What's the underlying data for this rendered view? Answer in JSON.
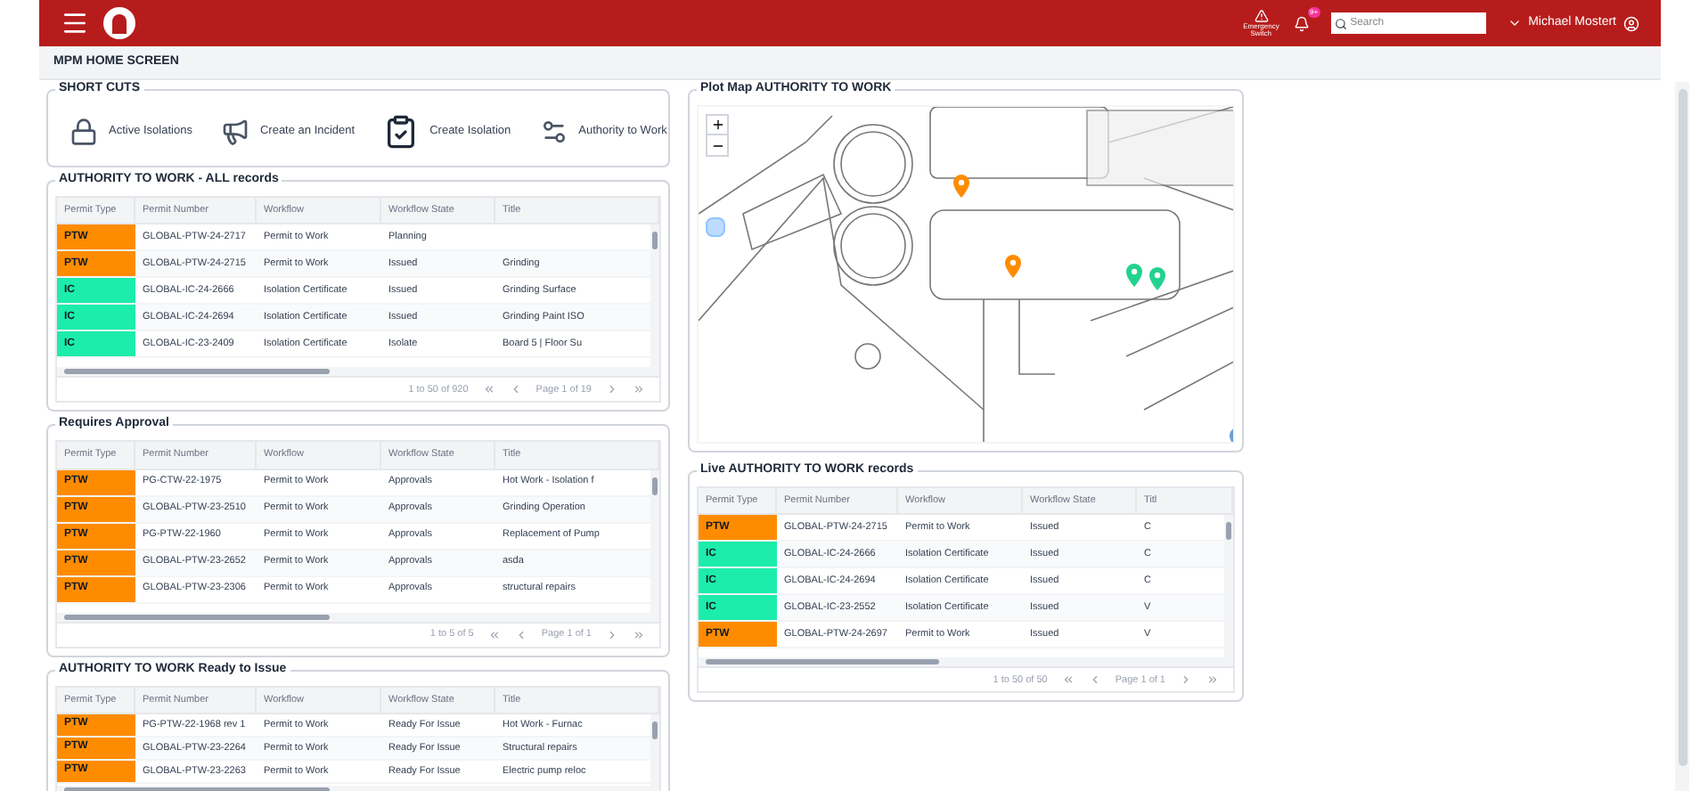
{
  "header": {
    "emergency_label": "Emergency Switch",
    "notification_badge": "9+",
    "search": {
      "placeholder": "Search"
    },
    "user": "Michael Mostert"
  },
  "page_title": "MPM HOME SCREEN",
  "shortcuts": {
    "title": "SHORT CUTS",
    "items": [
      {
        "kind": "isolations",
        "label": "Active Isolations"
      },
      {
        "kind": "incident",
        "label": "Create an Incident"
      },
      {
        "kind": "create_isolation",
        "label": "Create Isolation"
      },
      {
        "kind": "authority",
        "label": "Authority to Work"
      }
    ]
  },
  "tables": [
    {
      "title": "AUTHORITY TO WORK - ALL records",
      "columns": [
        "Permit Type",
        "Permit Number",
        "Workflow",
        "Workflow State",
        "Title"
      ],
      "rows": [
        {
          "cells": [
            "PTW",
            "GLOBAL-PTW-24-2717",
            "Permit to Work",
            "Planning",
            ""
          ],
          "color": "#ff8c00"
        },
        {
          "cells": [
            "PTW",
            "GLOBAL-PTW-24-2715",
            "Permit to Work",
            "Issued",
            "Grinding"
          ],
          "color": "#ff8c00"
        },
        {
          "cells": [
            "IC",
            "GLOBAL-IC-24-2666",
            "Isolation Certificate",
            "Issued",
            "Grinding Surface"
          ],
          "color": "#1dedaa"
        },
        {
          "cells": [
            "IC",
            "GLOBAL-IC-24-2694",
            "Isolation Certificate",
            "Issued",
            "Grinding Paint ISO"
          ],
          "color": "#1dedaa"
        },
        {
          "cells": [
            "IC",
            "GLOBAL-IC-23-2409",
            "Isolation Certificate",
            "Isolate",
            "Board 5 | Floor Su"
          ],
          "color": "#1dedaa"
        }
      ],
      "pager": {
        "range": "1 to 50 of 920",
        "page": "Page 1 of 19"
      }
    },
    {
      "title": "Requires Approval",
      "columns": [
        "Permit Type",
        "Permit Number",
        "Workflow",
        "Workflow State",
        "Title"
      ],
      "rows": [
        {
          "cells": [
            "PTW",
            "PG-CTW-22-1975",
            "Permit to Work",
            "Approvals",
            "Hot Work - Isolation f"
          ],
          "color": "#ff8c00"
        },
        {
          "cells": [
            "PTW",
            "GLOBAL-PTW-23-2510",
            "Permit to Work",
            "Approvals",
            "Grinding Operation"
          ],
          "color": "#ff8c00"
        },
        {
          "cells": [
            "PTW",
            "PG-PTW-22-1960",
            "Permit to Work",
            "Approvals",
            "Replacement of Pump"
          ],
          "color": "#ff8c00"
        },
        {
          "cells": [
            "PTW",
            "GLOBAL-PTW-23-2652",
            "Permit to Work",
            "Approvals",
            "asda"
          ],
          "color": "#ff8c00"
        },
        {
          "cells": [
            "PTW",
            "GLOBAL-PTW-23-2306",
            "Permit to Work",
            "Approvals",
            "structural repairs"
          ],
          "color": "#ff8c00"
        }
      ],
      "pager": {
        "range": "1 to 5 of 5",
        "page": "Page 1 of 1"
      }
    },
    {
      "title": "AUTHORITY TO WORK Ready to Issue",
      "columns": [
        "Permit Type",
        "Permit Number",
        "Workflow",
        "Workflow State",
        "Title"
      ],
      "rows": [
        {
          "cells": [
            "PTW",
            "PG-PTW-22-1968 rev 1",
            "Permit to Work",
            "Ready For Issue",
            "Hot Work - Furnac"
          ],
          "color": "#ff8c00"
        },
        {
          "cells": [
            "PTW",
            "GLOBAL-PTW-23-2264",
            "Permit to Work",
            "Ready For Issue",
            "Structural repairs"
          ],
          "color": "#ff8c00"
        },
        {
          "cells": [
            "PTW",
            "GLOBAL-PTW-23-2263",
            "Permit to Work",
            "Ready For Issue",
            "Electric pump reloc"
          ],
          "color": "#ff8c00"
        }
      ]
    }
  ],
  "map": {
    "title": "Plot Map AUTHORITY TO WORK",
    "pins": [
      {
        "color": "#ff8c00"
      },
      {
        "color": "#ff8c00"
      },
      {
        "color": "#22d38f"
      },
      {
        "color": "#22d38f"
      },
      {
        "color": "#6a9fd8"
      }
    ]
  },
  "live_table": {
    "title": "Live AUTHORITY TO WORK records",
    "columns": [
      "Permit Type",
      "Permit Number",
      "Workflow",
      "Workflow State",
      "Titl"
    ],
    "rows": [
      {
        "cells": [
          "PTW",
          "GLOBAL-PTW-24-2715",
          "Permit to Work",
          "Issued",
          "C"
        ],
        "color": "#ff8c00"
      },
      {
        "cells": [
          "IC",
          "GLOBAL-IC-24-2666",
          "Isolation Certificate",
          "Issued",
          "C"
        ],
        "color": "#1dedaa"
      },
      {
        "cells": [
          "IC",
          "GLOBAL-IC-24-2694",
          "Isolation Certificate",
          "Issued",
          "C"
        ],
        "color": "#1dedaa"
      },
      {
        "cells": [
          "IC",
          "GLOBAL-IC-23-2552",
          "Isolation Certificate",
          "Issued",
          "V"
        ],
        "color": "#1dedaa"
      },
      {
        "cells": [
          "PTW",
          "GLOBAL-PTW-24-2697",
          "Permit to Work",
          "Issued",
          "V"
        ],
        "color": "#ff8c00"
      }
    ],
    "pager": {
      "range": "1 to 50 of 50",
      "page": "Page 1 of 1"
    }
  }
}
